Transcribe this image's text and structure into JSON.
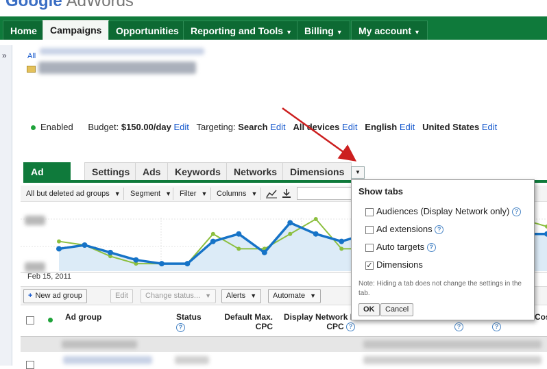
{
  "brand": {
    "google": "Google",
    "product": "AdWords"
  },
  "topnav": [
    {
      "label": "Home",
      "dropdown": false,
      "active": false
    },
    {
      "label": "Campaigns",
      "dropdown": false,
      "active": true
    },
    {
      "label": "Opportunities",
      "dropdown": false,
      "active": false
    },
    {
      "label": "Reporting and Tools",
      "dropdown": true,
      "active": false
    },
    {
      "label": "Billing",
      "dropdown": true,
      "active": false
    },
    {
      "label": "My account",
      "dropdown": true,
      "active": false
    }
  ],
  "leftbar": {
    "expand": "»"
  },
  "breadcrumb": {
    "root": "All"
  },
  "status": {
    "state": "Enabled",
    "budget_label": "Budget:",
    "budget_value": "$150.00/day",
    "edit": "Edit",
    "targeting_label": "Targeting:",
    "network": "Search",
    "devices": "All devices",
    "language": "English",
    "location": "United States"
  },
  "subtabs": [
    "Ad groups",
    "Settings",
    "Ads",
    "Keywords",
    "Networks",
    "Dimensions"
  ],
  "toolbar": {
    "filter_view": "All but deleted ad groups",
    "segment": "Segment",
    "filter": "Filter",
    "columns": "Columns"
  },
  "chart": {
    "date_label": "Feb 15, 2011"
  },
  "chart_data": {
    "type": "line",
    "series": [
      {
        "values": [
          3,
          3.5,
          2.5,
          1.5,
          1,
          1,
          4,
          5,
          2.5,
          6.5,
          5,
          4,
          5,
          4,
          5,
          4,
          4,
          3,
          5,
          5
        ]
      },
      {
        "values": [
          4,
          3.5,
          2,
          1,
          1,
          1,
          5,
          3,
          3,
          5,
          7,
          3,
          3,
          4.5,
          3,
          3,
          5,
          5,
          7,
          6
        ]
      }
    ],
    "colors": [
      "#1673c7",
      "#8cbf3f"
    ]
  },
  "actions": {
    "new_ad_group": "New ad group",
    "edit": "Edit",
    "change_status": "Change status...",
    "alerts": "Alerts",
    "automate": "Automate"
  },
  "table": {
    "headers": {
      "ad_group": "Ad group",
      "status": "Status",
      "default_max_cpc_1": "Default Max.",
      "default_max_cpc_2": "CPC",
      "display_network": "Display Network M",
      "display_network_2": "CPC",
      "cost": "Cos"
    }
  },
  "popup": {
    "title": "Show tabs",
    "options": [
      {
        "label": "Audiences (Display Network only)",
        "checked": false,
        "help": true
      },
      {
        "label": "Ad extensions",
        "checked": false,
        "help": true
      },
      {
        "label": "Auto targets",
        "checked": false,
        "help": true
      },
      {
        "label": "Dimensions",
        "checked": true,
        "help": false
      }
    ],
    "note": "Note: Hiding a tab does not change the settings in the tab.",
    "ok": "OK",
    "cancel": "Cancel"
  }
}
